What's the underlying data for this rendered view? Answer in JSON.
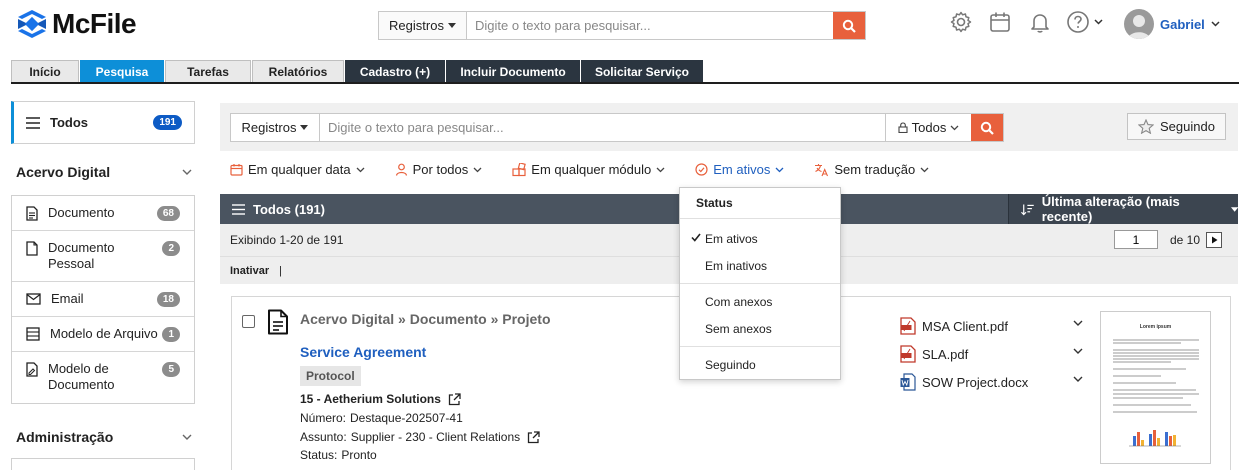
{
  "app": {
    "name": "McFile"
  },
  "header": {
    "search": {
      "scope": "Registros",
      "placeholder": "Digite o texto para pesquisar..."
    },
    "icons": [
      "gear-icon",
      "calendar-icon",
      "bell-icon",
      "help-icon"
    ],
    "user_name": "Gabriel"
  },
  "tabs": [
    {
      "label": "Início"
    },
    {
      "label": "Pesquisa"
    },
    {
      "label": "Tarefas"
    },
    {
      "label": "Relatórios"
    },
    {
      "label": "Cadastro (+)"
    },
    {
      "label": "Incluir Documento"
    },
    {
      "label": "Solicitar Serviço"
    }
  ],
  "sidebar": {
    "all": {
      "label": "Todos",
      "count": "191"
    },
    "section1": "Acervo Digital",
    "items": [
      {
        "label": "Documento",
        "count": "68"
      },
      {
        "label": "Documento Pessoal",
        "count": "2"
      },
      {
        "label": "Email",
        "count": "18"
      },
      {
        "label": "Modelo de Arquivo",
        "count": "1"
      },
      {
        "label": "Modelo de Documento",
        "count": "5"
      }
    ],
    "section2": "Administração"
  },
  "toolbar": {
    "scope": "Registros",
    "placeholder": "Digite o texto para pesquisar...",
    "filter_scope": "Todos",
    "follow_label": "Seguindo"
  },
  "filters": [
    {
      "label": "Em qualquer data",
      "icon": "calendar-icon"
    },
    {
      "label": "Por todos",
      "icon": "person-icon"
    },
    {
      "label": "Em qualquer módulo",
      "icon": "modules-icon"
    },
    {
      "label": "Em ativos",
      "icon": "check-circle-icon"
    },
    {
      "label": "Sem tradução",
      "icon": "translate-icon"
    }
  ],
  "results": {
    "title": "Todos (191)",
    "sort_label": "Última alteração (mais recente)",
    "showing": "Exibindo 1-20 de 191",
    "page": "1",
    "page_total": "de 10",
    "action": "Inativar",
    "action_sep": "|"
  },
  "card": {
    "breadcrumb": "Acervo Digital » Documento » Projeto",
    "title": "Service Agreement",
    "tag": "Protocol",
    "company": "15 - Aetherium Solutions",
    "numero_label": "Número:",
    "numero_value": "Destaque-202507-41",
    "assunto_label": "Assunto:",
    "assunto_value": "Supplier - 230 - Client Relations",
    "status_label": "Status:",
    "status_value": "Pronto",
    "attachments": [
      {
        "name": "MSA Client.pdf",
        "type": "pdf"
      },
      {
        "name": "SLA.pdf",
        "type": "pdf"
      },
      {
        "name": "SOW Project.docx",
        "type": "docx"
      }
    ],
    "thumb_title": "Lorem ipsum"
  },
  "dropdown": {
    "header": "Status",
    "items_a": [
      "Em ativos",
      "Em inativos"
    ],
    "items_b": [
      "Com anexos",
      "Sem anexos"
    ],
    "items_c": [
      "Seguindo"
    ]
  },
  "colors": {
    "accent": "#0d8fd8",
    "orange": "#e8603c",
    "dark": "#2b3540",
    "link": "#1f5fbf"
  }
}
